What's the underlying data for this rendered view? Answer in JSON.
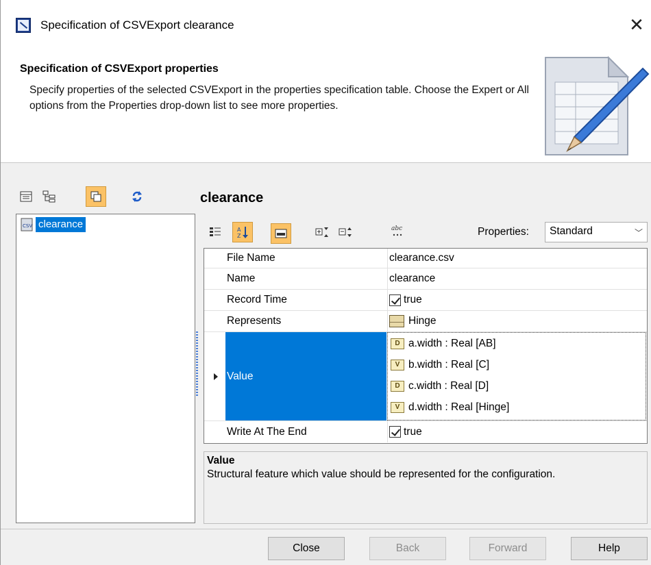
{
  "window": {
    "title": "Specification of CSVExport clearance",
    "close_glyph": "✕"
  },
  "banner": {
    "title": "Specification of CSVExport properties",
    "description": "Specify properties of the selected CSVExport in the properties specification table. Choose the Expert or All options from the Properties drop-down list to see more properties."
  },
  "left_toolbar": {
    "buttons": [
      {
        "icon": "list-view-icon",
        "active": false
      },
      {
        "icon": "tree-view-icon",
        "active": false
      },
      {
        "icon": "copy-view-icon",
        "active": true
      },
      {
        "icon": "refresh-icon",
        "active": false
      }
    ]
  },
  "tree": {
    "items": [
      {
        "label": "clearance",
        "icon": "csv-file-icon",
        "selected": true
      }
    ]
  },
  "panel": {
    "title": "clearance",
    "properties_label": "Properties:",
    "properties_value": "Standard"
  },
  "grid": {
    "rows": [
      {
        "name": "File Name",
        "value": "clearance.csv"
      },
      {
        "name": "Name",
        "value": "clearance"
      },
      {
        "name": "Record Time",
        "value": "true",
        "checked": true
      },
      {
        "name": "Represents",
        "value": "Hinge",
        "icon": "block-icon"
      },
      {
        "name": "Value",
        "selected": true,
        "values": [
          {
            "badge": "D",
            "text": "a.width : Real [AB]"
          },
          {
            "badge": "V",
            "text": "b.width : Real [C]"
          },
          {
            "badge": "D",
            "text": "c.width : Real [D]"
          },
          {
            "badge": "V",
            "text": "d.width : Real [Hinge]"
          }
        ]
      },
      {
        "name": "Write At The End",
        "value": "true",
        "checked": true
      }
    ]
  },
  "description": {
    "title": "Value",
    "text": "Structural feature which value should be represented for the configuration."
  },
  "buttons": {
    "close": "Close",
    "back": "Back",
    "forward": "Forward",
    "help": "Help"
  }
}
